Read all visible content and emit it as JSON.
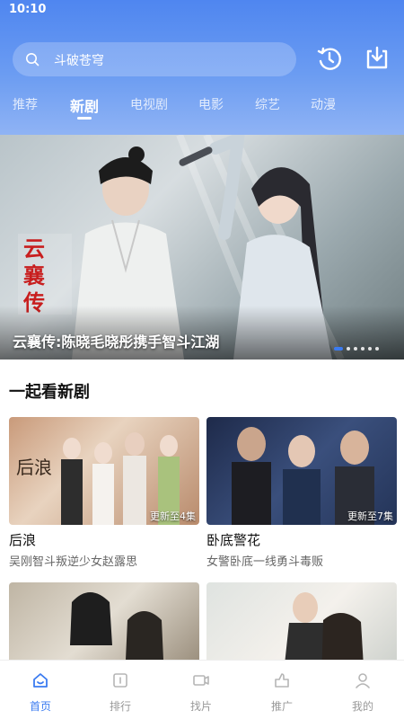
{
  "status_bar": {
    "time": "10:10"
  },
  "search": {
    "placeholder": "斗破苍穹"
  },
  "header_icons": {
    "history": "history-icon",
    "download": "download-icon"
  },
  "tabs": [
    {
      "label": "推荐",
      "active": false
    },
    {
      "label": "新剧",
      "active": true
    },
    {
      "label": "电视剧",
      "active": false
    },
    {
      "label": "电影",
      "active": false
    },
    {
      "label": "综艺",
      "active": false
    },
    {
      "label": "动漫",
      "active": false
    }
  ],
  "banner": {
    "caption": "云襄传:陈晓毛晓彤携手智斗江湖",
    "poster_title": "云襄传",
    "slide_count": 6,
    "active_slide": 1
  },
  "section": {
    "title": "一起看新剧"
  },
  "cards": [
    {
      "title": "后浪",
      "desc": "吴刚智斗叛逆少女赵露思",
      "badge": "更新至4集",
      "poster_text": "后浪"
    },
    {
      "title": "卧底警花",
      "desc": "女警卧底一线勇斗毒贩",
      "badge": "更新至7集",
      "poster_text": ""
    },
    {
      "title": "",
      "desc": "",
      "badge": "",
      "poster_text": ""
    },
    {
      "title": "",
      "desc": "",
      "badge": "",
      "poster_text": ""
    }
  ],
  "bottom_nav": [
    {
      "label": "首页",
      "icon": "home-icon",
      "active": true
    },
    {
      "label": "排行",
      "icon": "ranking-icon",
      "active": false
    },
    {
      "label": "找片",
      "icon": "video-icon",
      "active": false
    },
    {
      "label": "推广",
      "icon": "promote-icon",
      "active": false
    },
    {
      "label": "我的",
      "icon": "profile-icon",
      "active": false
    }
  ],
  "colors": {
    "accent": "#3b7bf0",
    "header_top": "#4f86f0",
    "header_bottom": "#8fb3f4"
  }
}
